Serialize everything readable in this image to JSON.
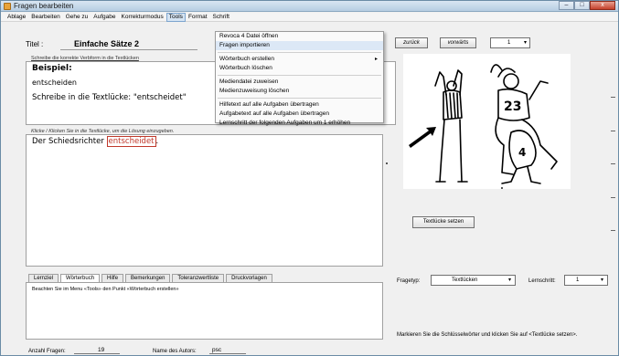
{
  "window": {
    "title": "Fragen bearbeiten",
    "controls": {
      "minimize": "–",
      "maximize": "□",
      "close": "x"
    }
  },
  "menubar": {
    "items": [
      "Ablage",
      "Bearbeiten",
      "Gehe zu",
      "Aufgabe",
      "Korrekturmodus",
      "Tools",
      "Format",
      "Schrift"
    ],
    "open_menu": "Tools"
  },
  "tools_menu": {
    "items": [
      {
        "label": "Revoca 4 Datei öffnen"
      },
      {
        "label": "Fragen importieren",
        "highlighted": true
      },
      {
        "label": "Wörterbuch erstellen",
        "submenu": true
      },
      {
        "label": "Wörterbuch löschen"
      },
      {
        "label": "Mediendatei zuweisen"
      },
      {
        "label": "Medienzuweisung löschen"
      },
      {
        "label": "Hilfetext auf alle Aufgaben übertragen"
      },
      {
        "label": "Aufgabetext auf alle Aufgaben übertragen"
      },
      {
        "label": "Lernschritt der folgenden Aufgaben um 1 erhöhen"
      }
    ],
    "submenu_arrow": "▸"
  },
  "titel": {
    "label": "Titel :",
    "value": "Einfache Sätze 2"
  },
  "instruction": {
    "label": "Schreibe die korrekte Verbform in die Textlücken",
    "example_title": "Beispiel:",
    "line1": "entscheiden",
    "line2": "Schreibe in die Textlücke: \"entscheidet\""
  },
  "solution": {
    "hint": "Klicke / Klicken Sie in die Textlücke, um die Lösung einzugeben.",
    "sentence_prefix": "Der Schiedsrichter ",
    "gap_word": "entscheidet",
    "sentence_suffix": "."
  },
  "tabs": {
    "items": [
      "Lernziel",
      "Wörterbuch",
      "Hilfe",
      "Bemerkungen",
      "Toleranzwertliste",
      "Druckvorlagen"
    ],
    "active": "Wörterbuch",
    "panel_text": "Beachten Sie im Menu «Tools» den Punkt «Wörterbuch erstellen»"
  },
  "footer": {
    "count_label": "Anzahl Fragen:",
    "count_value": "19",
    "author_label": "Name des Autors:",
    "author_value": "psc"
  },
  "navigation": {
    "back_label": "zurück",
    "forward_label": "vorwärts",
    "page_value": "1",
    "dropdown_arrow": "▾"
  },
  "image": {
    "jersey_number_1": "23",
    "jersey_number_2": "4"
  },
  "set_gap_button": "Textlücke setzen",
  "question_type": {
    "label": "Fragetyp:",
    "value": "Textlücken"
  },
  "learning_step": {
    "label": "Lernschritt:",
    "value": "1"
  },
  "bottom_hint": "Markieren Sie die Schlüsselwörter und klicken Sie auf <Textlücke setzen>."
}
